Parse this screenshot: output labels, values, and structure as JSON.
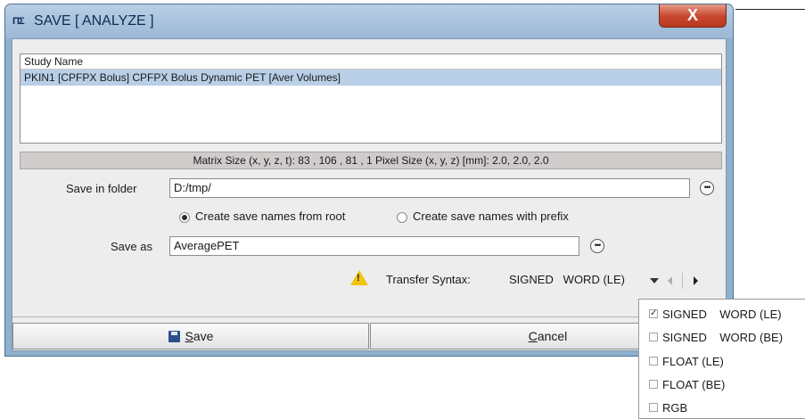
{
  "window": {
    "title": "SAVE [ ANALYZE ]",
    "app_icon": "PMOD",
    "close_symbol": "X"
  },
  "list": {
    "header": "Study Name",
    "rows": [
      "PKIN1 [CPFPX Bolus] CPFPX Bolus Dynamic PET [Aver Volumes]"
    ]
  },
  "matrix_info": "Matrix Size (x, y, z, t): 83 , 106 , 81 , 1   Pixel Size (x, y, z) [mm]: 2.0, 2.0, 2.0",
  "folder": {
    "label": "Save in folder",
    "value": "D:/tmp/"
  },
  "naming": {
    "option_root": "Create save names from root",
    "option_prefix": "Create save names with prefix",
    "selected": "root"
  },
  "save_as": {
    "label": "Save as",
    "value": "AveragePET"
  },
  "transfer": {
    "label": "Transfer Syntax:",
    "value": "SIGNED   WORD (LE)"
  },
  "buttons": {
    "save": "Save",
    "save_mnemonic": "S",
    "cancel": "Cancel",
    "cancel_mnemonic": "C"
  },
  "dropdown": {
    "items": [
      {
        "label": "SIGNED    WORD (LE)",
        "checked": true
      },
      {
        "label": "SIGNED    WORD (BE)",
        "checked": false
      },
      {
        "label": "FLOAT (LE)",
        "checked": false
      },
      {
        "label": "FLOAT (BE)",
        "checked": false
      },
      {
        "label": "RGB",
        "checked": false
      }
    ]
  },
  "colors": {
    "selection": "#b8cfe7",
    "window_frame": "#8fb0cf",
    "close_button": "#c8452c",
    "warning": "#f1c40f"
  },
  "icons": [
    "pmod-app-icon",
    "close-icon",
    "browse-icon",
    "warning-icon",
    "dropdown-arrow-icon",
    "previous-arrow-icon",
    "next-arrow-icon",
    "save-disk-icon"
  ]
}
